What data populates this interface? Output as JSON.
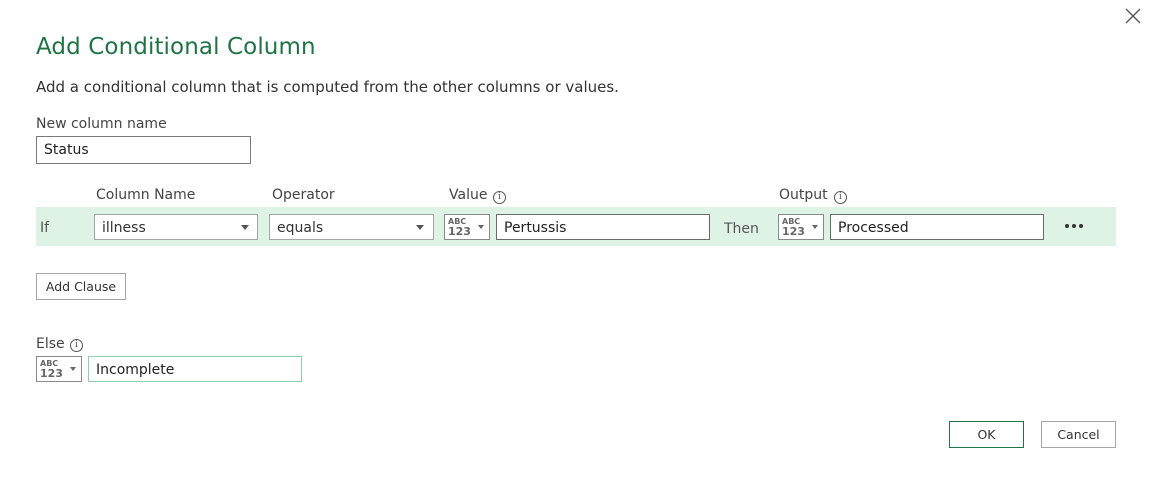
{
  "dialog": {
    "title": "Add Conditional Column",
    "description": "Add a conditional column that is computed from the other columns or values.",
    "close_icon": "close-icon"
  },
  "new_column": {
    "label": "New column name",
    "value": "Status"
  },
  "clause_headers": {
    "column_name": "Column Name",
    "operator": "Operator",
    "value": "Value",
    "output": "Output"
  },
  "clause": {
    "if_label": "If",
    "column": "illness",
    "operator": "equals",
    "value_type": {
      "abc": "ABC",
      "num": "123"
    },
    "value": "Pertussis",
    "then_label": "Then",
    "output_type": {
      "abc": "ABC",
      "num": "123"
    },
    "output": "Processed",
    "more_icon": "more-horizontal-icon"
  },
  "add_clause": "Add Clause",
  "else": {
    "label": "Else",
    "type": {
      "abc": "ABC",
      "num": "123"
    },
    "value": "Incomplete"
  },
  "footer": {
    "ok": "OK",
    "cancel": "Cancel"
  },
  "colors": {
    "accent": "#217346",
    "row_highlight": "#dff2e6"
  }
}
